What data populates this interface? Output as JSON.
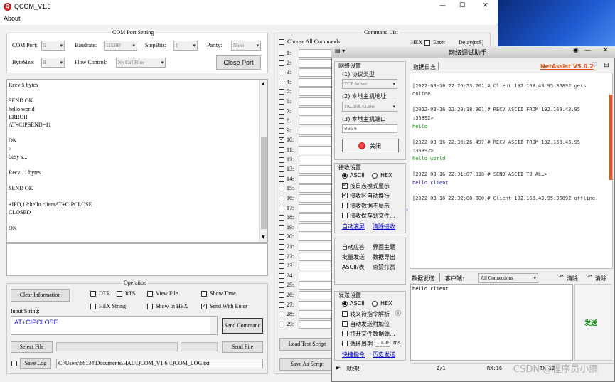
{
  "window": {
    "title": "QCOM_V1.6",
    "menu": [
      "About"
    ],
    "min": "—",
    "max": "☐",
    "close": "✕"
  },
  "com": {
    "group_title": "COM Port Setting",
    "port_label": "COM Port:",
    "port_value": "5",
    "baud_label": "Baudrate:",
    "baud_value": "115200",
    "stop_label": "StopBits:",
    "stop_value": "1",
    "parity_label": "Parity:",
    "parity_value": "None",
    "bytesize_label": "ByteSize:",
    "bytesize_value": "8",
    "flow_label": "Flow Control:",
    "flow_value": "No Ctrl Flow",
    "close_port": "Close Port"
  },
  "receive_lines": [
    "Recv 5 bytes",
    "",
    "SEND OK",
    "hello world",
    "ERROR",
    "AT+CIPSEND=11",
    "",
    "OK",
    ">",
    "busy s...",
    "",
    "Recv 11 bytes",
    "",
    "SEND OK",
    "",
    "+IPD,12:hello clientAT+CIPCLOSE",
    "CLOSED",
    "",
    "OK"
  ],
  "operation": {
    "group_title": "Operation",
    "clear_info": "Clear Information",
    "dtr": "DTR",
    "rts": "RTS",
    "view_file": "View File",
    "show_time": "Show Time",
    "hex_string": "HEX String",
    "show_in_hex": "Show In HEX",
    "send_with_enter": "Send With Enter",
    "input_label": "Input String:",
    "input_value": "AT+CIPCLOSE",
    "send_command": "Send Command",
    "select_file": "Select File",
    "send_file": "Send File",
    "save_log": "Save Log",
    "log_path": "C:\\Users\\86134\\Documents\\HAL\\QCOM_V1.6 \\QCOM_LOG.txt"
  },
  "command_list": {
    "title": "Command List",
    "choose_all": "Choose All Commands",
    "hex": "HEX",
    "enter": "Enter",
    "delay": "Delay(mS)",
    "rows": [
      {
        "num": "1:",
        "checked": false
      },
      {
        "num": "2:",
        "checked": false
      },
      {
        "num": "3:",
        "checked": false
      },
      {
        "num": "4:",
        "checked": false
      },
      {
        "num": "5:",
        "checked": false
      },
      {
        "num": "6:",
        "checked": false
      },
      {
        "num": "7:",
        "checked": false
      },
      {
        "num": "8:",
        "checked": false
      },
      {
        "num": "9:",
        "checked": false
      },
      {
        "num": "10:",
        "checked": true
      },
      {
        "num": "11:",
        "checked": false
      },
      {
        "num": "12:",
        "checked": false
      },
      {
        "num": "13:",
        "checked": false
      },
      {
        "num": "14:",
        "checked": false
      },
      {
        "num": "15:",
        "checked": false
      },
      {
        "num": "16:",
        "checked": false
      },
      {
        "num": "17:",
        "checked": false
      },
      {
        "num": "18:",
        "checked": false
      },
      {
        "num": "19:",
        "checked": false
      },
      {
        "num": "20:",
        "checked": false
      },
      {
        "num": "21:",
        "checked": false
      },
      {
        "num": "22:",
        "checked": false
      },
      {
        "num": "23:",
        "checked": false
      },
      {
        "num": "24:",
        "checked": false
      },
      {
        "num": "25:",
        "checked": false
      },
      {
        "num": "26:",
        "checked": false
      },
      {
        "num": "27:",
        "checked": false
      },
      {
        "num": "28:",
        "checked": false
      },
      {
        "num": "29:",
        "checked": false
      }
    ],
    "load_script": "Load Test Script",
    "save_script": "Save As Script"
  },
  "netassist": {
    "title": "网络调试助手",
    "brand": "NetAssist V5.0.2",
    "net_settings": "网络设置",
    "proto_label": "(1) 协议类型",
    "proto_value": "TCP Server",
    "host_label": "(2) 本地主机地址",
    "host_value": "192.168.43.166",
    "port_label": "(3) 本地主机端口",
    "port_value": "9999",
    "close_btn": "关闭",
    "recv_settings": "接收设置",
    "ascii": "ASCII",
    "hex": "HEX",
    "log_mode": "按日志模式显示",
    "auto_wrap": "接收区自动换行",
    "hide_recv": "接收数据不显示",
    "save_file": "接收保存到文件...",
    "auto_scroll": "自动滚屏",
    "clear_recv": "清除接收",
    "auto_reply": "自动应答",
    "ui_theme": "界面主题",
    "batch_send": "批量发送",
    "export": "数据导出",
    "ascii_table": "ASCII/表",
    "lucky": "点赞打赏",
    "send_settings": "发送设置",
    "escape": "转义符指令解析",
    "auto_append": "自动发送附加位",
    "open_file": "打开文件数据源...",
    "cycle": "循环周期",
    "cycle_value": "1000",
    "ms": "ms",
    "shortcut": "快捷指令",
    "history": "历史发送",
    "status": "就绪!",
    "log_tab": "数据日志",
    "send_tab": "数据发送",
    "client_label": "客户端:",
    "client_value": "All Connections",
    "clear1": "清除",
    "clear2": "清除",
    "send_text": "hello client",
    "send_btn": "发送",
    "count": "2/1",
    "rx": "RX:16",
    "tx": "TX:12",
    "log": [
      {
        "text": "[2022-03-16 22:26:53.201]# Client 192.168.43.95:36892 gets",
        "kind": "info"
      },
      {
        "text": "online.",
        "kind": "info"
      },
      {
        "text": "[2022-03-16 22:29:18.901]# RECV ASCII FROM 192.168.43.95",
        "kind": "info"
      },
      {
        "text": ":36892>",
        "kind": "info"
      },
      {
        "text": "hello",
        "kind": "data"
      },
      {
        "text": "[2022-03-16 22:30:26.497]# RECV ASCII FROM 192.168.43.95",
        "kind": "info"
      },
      {
        "text": ":36892>",
        "kind": "info"
      },
      {
        "text": "hello world",
        "kind": "data"
      },
      {
        "text": "[2022-03-16 22:31:07.018]# SEND ASCII TO ALL>",
        "kind": "info"
      },
      {
        "text": "hello client",
        "kind": "send"
      },
      {
        "text": "[2022-03-16 22:32:08.800]# Client 192.168.43.95:36892 offline.",
        "kind": "info"
      }
    ]
  },
  "watermark": "CSDN @程序员小康"
}
